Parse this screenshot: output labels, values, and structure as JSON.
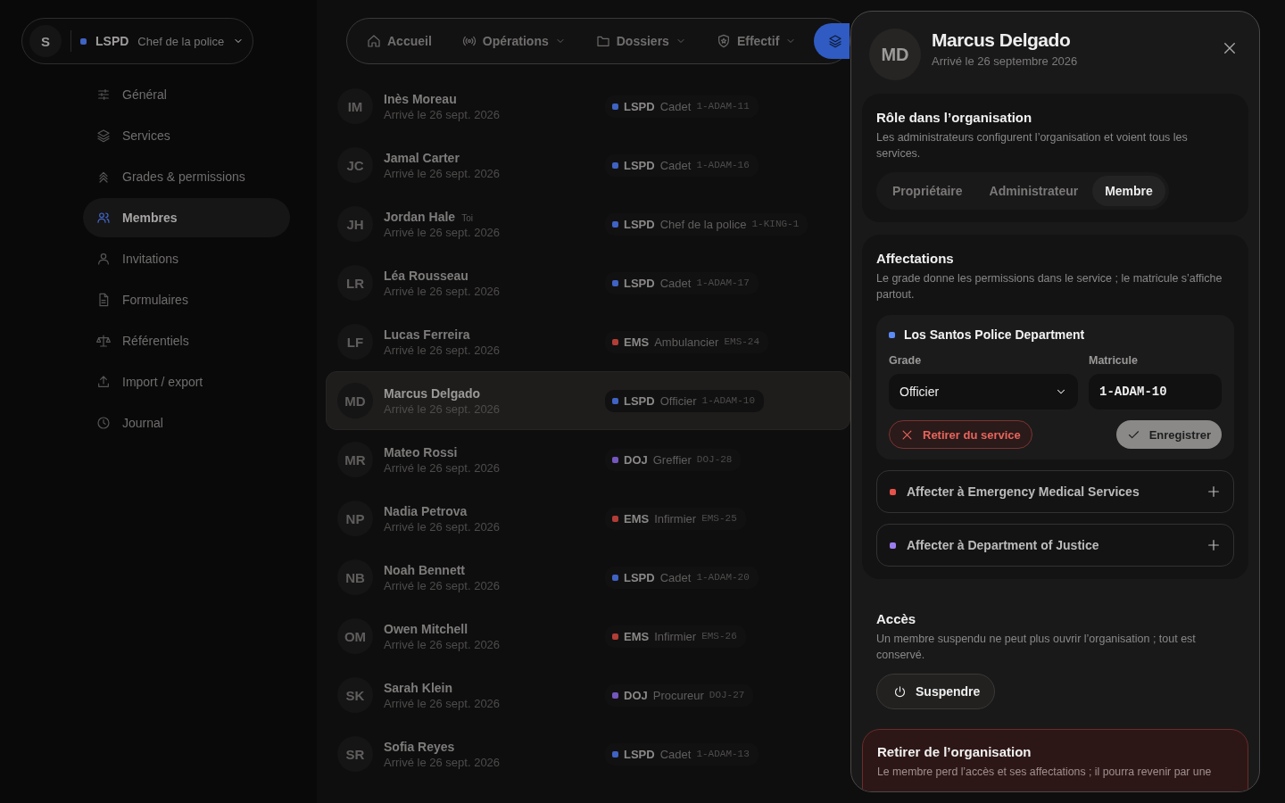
{
  "org_switcher": {
    "initial": "S",
    "org": "LSPD",
    "role": "Chef de la police",
    "color": "#3f63c4"
  },
  "sidebar": {
    "items": [
      {
        "label": "Général",
        "selected": false
      },
      {
        "label": "Services",
        "selected": false
      },
      {
        "label": "Grades & permissions",
        "selected": false
      },
      {
        "label": "Membres",
        "selected": true
      },
      {
        "label": "Invitations",
        "selected": false
      },
      {
        "label": "Formulaires",
        "selected": false
      },
      {
        "label": "Référentiels",
        "selected": false
      },
      {
        "label": "Import / export",
        "selected": false
      },
      {
        "label": "Journal",
        "selected": false
      }
    ]
  },
  "nav_bar": {
    "items": [
      {
        "label": "Accueil",
        "dropdown": false
      },
      {
        "label": "Opérations",
        "dropdown": true
      },
      {
        "label": "Dossiers",
        "dropdown": true
      },
      {
        "label": "Effectif",
        "dropdown": true
      }
    ]
  },
  "members": [
    {
      "initials": "IM",
      "name": "Inès Moreau",
      "joined": "Arrivé le 26 sept. 2026",
      "service": "LSPD",
      "color": "#3f63c4",
      "grade": "Cadet",
      "badge": "1-ADAM-11",
      "selected": false
    },
    {
      "initials": "JC",
      "name": "Jamal Carter",
      "joined": "Arrivé le 26 sept. 2026",
      "service": "LSPD",
      "color": "#3f63c4",
      "grade": "Cadet",
      "badge": "1-ADAM-16",
      "selected": false
    },
    {
      "initials": "JH",
      "name": "Jordan Hale",
      "tag": "Toi",
      "joined": "Arrivé le 26 sept. 2026",
      "service": "LSPD",
      "color": "#3f63c4",
      "grade": "Chef de la police",
      "badge": "1-KING-1",
      "selected": false
    },
    {
      "initials": "LR",
      "name": "Léa Rousseau",
      "joined": "Arrivé le 26 sept. 2026",
      "service": "LSPD",
      "color": "#3f63c4",
      "grade": "Cadet",
      "badge": "1-ADAM-17",
      "selected": false
    },
    {
      "initials": "LF",
      "name": "Lucas Ferreira",
      "joined": "Arrivé le 26 sept. 2026",
      "service": "EMS",
      "color": "#b23d36",
      "grade": "Ambulancier",
      "badge": "EMS-24",
      "selected": false
    },
    {
      "initials": "MD",
      "name": "Marcus Delgado",
      "joined": "Arrivé le 26 sept. 2026",
      "service": "LSPD",
      "color": "#3f63c4",
      "grade": "Officier",
      "badge": "1-ADAM-10",
      "selected": true
    },
    {
      "initials": "MR",
      "name": "Mateo Rossi",
      "joined": "Arrivé le 26 sept. 2026",
      "service": "DOJ",
      "color": "#7456c0",
      "grade": "Greffier",
      "badge": "DOJ-28",
      "selected": false
    },
    {
      "initials": "NP",
      "name": "Nadia Petrova",
      "joined": "Arrivé le 26 sept. 2026",
      "service": "EMS",
      "color": "#b23d36",
      "grade": "Infirmier",
      "badge": "EMS-25",
      "selected": false
    },
    {
      "initials": "NB",
      "name": "Noah Bennett",
      "joined": "Arrivé le 26 sept. 2026",
      "service": "LSPD",
      "color": "#3f63c4",
      "grade": "Cadet",
      "badge": "1-ADAM-20",
      "selected": false
    },
    {
      "initials": "OM",
      "name": "Owen Mitchell",
      "joined": "Arrivé le 26 sept. 2026",
      "service": "EMS",
      "color": "#b23d36",
      "grade": "Infirmier",
      "badge": "EMS-26",
      "selected": false
    },
    {
      "initials": "SK",
      "name": "Sarah Klein",
      "joined": "Arrivé le 26 sept. 2026",
      "service": "DOJ",
      "color": "#7456c0",
      "grade": "Procureur",
      "badge": "DOJ-27",
      "selected": false
    },
    {
      "initials": "SR",
      "name": "Sofia Reyes",
      "joined": "Arrivé le 26 sept. 2026",
      "service": "LSPD",
      "color": "#3f63c4",
      "grade": "Cadet",
      "badge": "1-ADAM-13",
      "selected": false
    }
  ],
  "panel": {
    "initials": "MD",
    "name": "Marcus Delgado",
    "joined": "Arrivé le 26 septembre 2026",
    "role": {
      "title": "Rôle dans l’organisation",
      "description": "Les administrateurs configurent l’organisation et voient tous les services.",
      "options": [
        {
          "label": "Propriétaire",
          "selected": false
        },
        {
          "label": "Administrateur",
          "selected": false
        },
        {
          "label": "Membre",
          "selected": true
        }
      ]
    },
    "assignments": {
      "title": "Affectations",
      "description": "Le grade donne les permissions dans le service ; le matricule s’affiche partout.",
      "current": {
        "service": "Los Santos Police Department",
        "color": "#5b8cf5",
        "grade_label": "Grade",
        "grade": "Officier",
        "matricule_label": "Matricule",
        "matricule": "1-ADAM-10",
        "remove": "Retirer du service",
        "save": "Enregistrer"
      },
      "add": [
        {
          "label": "Affecter à Emergency Medical Services",
          "color": "#e5534b"
        },
        {
          "label": "Affecter à Department of Justice",
          "color": "#9b7cf0"
        }
      ]
    },
    "access": {
      "title": "Accès",
      "description": "Un membre suspendu ne peut plus ouvrir l’organisation ; tout est conservé.",
      "button": "Suspendre"
    },
    "danger": {
      "title": "Retirer de l’organisation",
      "description": "Le membre perd l’accès et ses affectations ; il pourra revenir par une"
    }
  }
}
